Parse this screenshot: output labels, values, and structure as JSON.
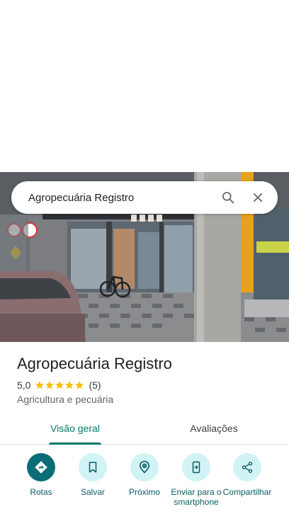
{
  "search": {
    "query": "Agropecuária Registro"
  },
  "place": {
    "name": "Agropecuária Registro",
    "rating": "5,0",
    "stars": 5,
    "review_count": "(5)",
    "category": "Agricultura e pecuária"
  },
  "tabs": [
    {
      "label": "Visão geral",
      "selected": true
    },
    {
      "label": "Avaliações",
      "selected": false
    }
  ],
  "actions": [
    {
      "label": "Rotas",
      "icon": "directions-icon"
    },
    {
      "label": "Salvar",
      "icon": "bookmark-icon"
    },
    {
      "label": "Próximo",
      "icon": "nearby-icon"
    },
    {
      "label": "Enviar para o smartphone",
      "icon": "send-to-phone-icon"
    },
    {
      "label": "Compartilhar",
      "icon": "share-icon"
    }
  ],
  "colors": {
    "accent": "#00796b",
    "action_bg": "#d2f3f6",
    "action_primary": "#0b6e76",
    "star": "#fbbc04"
  }
}
